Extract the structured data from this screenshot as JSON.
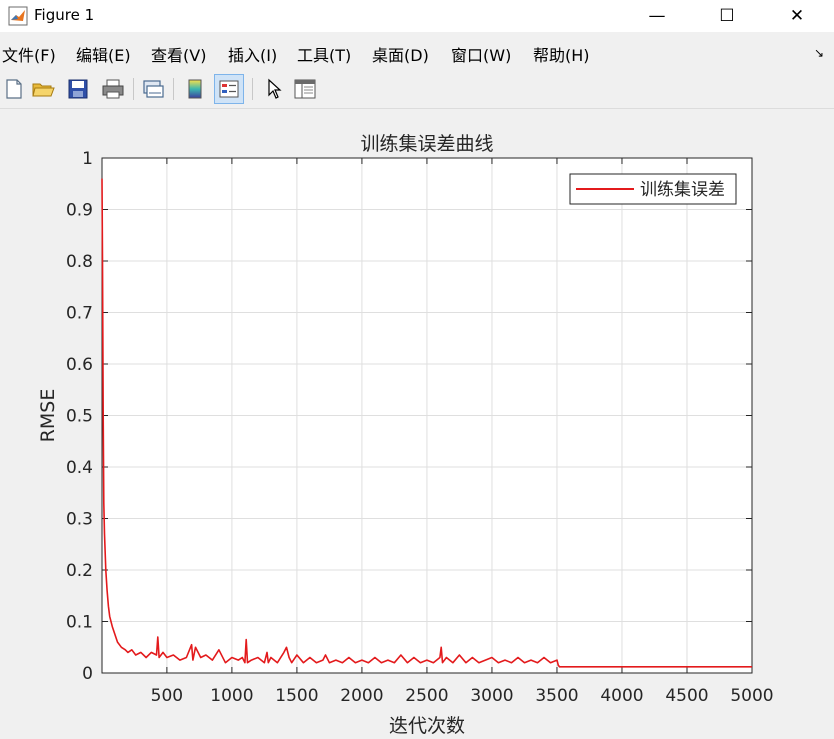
{
  "window": {
    "title": "Figure 1",
    "minimize_glyph": "—",
    "maximize_glyph": "☐",
    "close_glyph": "✕"
  },
  "menu": {
    "items": [
      "文件(F)",
      "编辑(E)",
      "查看(V)",
      "插入(I)",
      "工具(T)",
      "桌面(D)",
      "窗口(W)",
      "帮助(H)"
    ],
    "overflow_glyph": "↘"
  },
  "toolbar": {
    "icons": [
      "new-figure-icon",
      "open-file-icon",
      "save-icon",
      "print-icon",
      "link-plot-icon",
      "colorbar-icon",
      "legend-icon",
      "pointer-icon",
      "property-inspector-icon"
    ]
  },
  "colors": {
    "line": "#e31a1c",
    "axes_bg": "#ffffff",
    "figure_bg": "#f0f0f0",
    "grid": "#dfdfdf",
    "text": "#262626"
  },
  "chart_data": {
    "type": "line",
    "title": "训练集误差曲线",
    "xlabel": "迭代次数",
    "ylabel": "RMSE",
    "xlim": [
      1,
      5000
    ],
    "ylim": [
      0,
      1
    ],
    "xticks": [
      500,
      1000,
      1500,
      2000,
      2500,
      3000,
      3500,
      4000,
      4500,
      5000
    ],
    "yticks": [
      0,
      0.1,
      0.2,
      0.3,
      0.4,
      0.5,
      0.6,
      0.7,
      0.8,
      0.9,
      1
    ],
    "ytick_labels": [
      "0",
      "0.1",
      "0.2",
      "0.3",
      "0.4",
      "0.5",
      "0.6",
      "0.7",
      "0.8",
      "0.9",
      "1"
    ],
    "grid": true,
    "legend": {
      "position": "top-right",
      "entries": [
        "训练集误差"
      ]
    },
    "series": [
      {
        "name": "训练集误差",
        "color": "#e31a1c",
        "x": [
          1,
          5,
          10,
          15,
          20,
          30,
          40,
          50,
          60,
          80,
          100,
          120,
          150,
          180,
          200,
          230,
          260,
          300,
          340,
          380,
          420,
          430,
          440,
          470,
          500,
          550,
          600,
          650,
          690,
          700,
          720,
          760,
          800,
          850,
          900,
          950,
          1000,
          1050,
          1080,
          1100,
          1110,
          1120,
          1150,
          1200,
          1250,
          1270,
          1280,
          1300,
          1350,
          1400,
          1420,
          1440,
          1460,
          1500,
          1550,
          1600,
          1650,
          1700,
          1720,
          1750,
          1800,
          1850,
          1900,
          1950,
          2000,
          2050,
          2100,
          2150,
          2200,
          2250,
          2300,
          2350,
          2400,
          2450,
          2500,
          2550,
          2600,
          2610,
          2620,
          2650,
          2700,
          2750,
          2800,
          2850,
          2900,
          2950,
          3000,
          3050,
          3100,
          3150,
          3200,
          3250,
          3300,
          3350,
          3400,
          3450,
          3500,
          3510,
          3520,
          3600,
          3700,
          3800,
          3900,
          4000,
          4100,
          4200,
          4300,
          4400,
          4500,
          4600,
          4700,
          4800,
          4900,
          5000
        ],
        "y": [
          0.96,
          0.8,
          0.5,
          0.33,
          0.27,
          0.2,
          0.16,
          0.13,
          0.11,
          0.09,
          0.075,
          0.06,
          0.05,
          0.045,
          0.04,
          0.045,
          0.035,
          0.04,
          0.03,
          0.04,
          0.035,
          0.07,
          0.03,
          0.04,
          0.03,
          0.035,
          0.025,
          0.03,
          0.055,
          0.025,
          0.05,
          0.03,
          0.035,
          0.025,
          0.045,
          0.02,
          0.03,
          0.025,
          0.03,
          0.02,
          0.065,
          0.02,
          0.025,
          0.03,
          0.02,
          0.04,
          0.02,
          0.03,
          0.02,
          0.04,
          0.05,
          0.03,
          0.02,
          0.035,
          0.02,
          0.03,
          0.02,
          0.025,
          0.035,
          0.02,
          0.025,
          0.02,
          0.03,
          0.02,
          0.025,
          0.02,
          0.03,
          0.02,
          0.025,
          0.02,
          0.035,
          0.02,
          0.03,
          0.02,
          0.025,
          0.02,
          0.03,
          0.05,
          0.02,
          0.03,
          0.02,
          0.035,
          0.02,
          0.03,
          0.02,
          0.025,
          0.03,
          0.02,
          0.025,
          0.02,
          0.03,
          0.02,
          0.025,
          0.02,
          0.03,
          0.02,
          0.025,
          0.015,
          0.012,
          0.012,
          0.012,
          0.012,
          0.012,
          0.012,
          0.012,
          0.012,
          0.012,
          0.012,
          0.012,
          0.012,
          0.012,
          0.012,
          0.012,
          0.012
        ]
      }
    ]
  }
}
